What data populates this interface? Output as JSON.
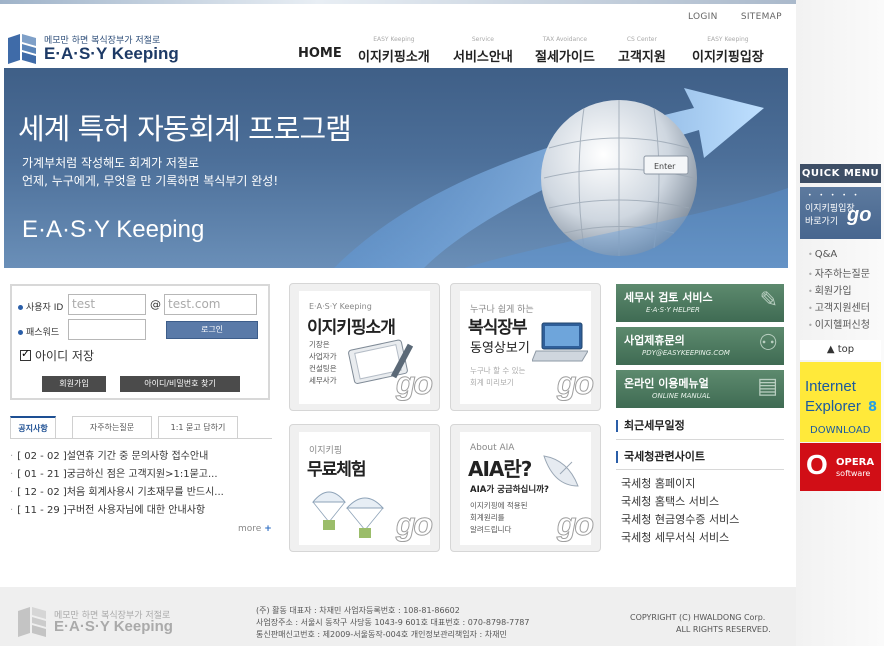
{
  "header": {
    "util_links": [
      "LOGIN",
      "SITEMAP"
    ],
    "logo_tagline": "메모만 하면 복식장부가 저절로",
    "logo_brand": "E·A·S·Y Keeping",
    "nav": [
      {
        "sub": "",
        "label": "HOME"
      },
      {
        "sub": "EASY Keeping",
        "label": "이지키핑소개"
      },
      {
        "sub": "Service",
        "label": "서비스안내"
      },
      {
        "sub": "TAX Avoidance",
        "label": "절세가이드"
      },
      {
        "sub": "CS Center",
        "label": "고객지원"
      },
      {
        "sub": "EASY Keeping",
        "label": "이지키핑입장"
      }
    ]
  },
  "hero": {
    "title": "세계 특허 자동회계 프로그램",
    "line1": "가계부처럼 작성해도 회계가 저절로",
    "line2": "언제, 누구에게, 무엇을 만 기록하면 복식부기 완성!",
    "brand": "E·A·S·Y Keeping",
    "enter_key": "Enter"
  },
  "login": {
    "id_label": "사용자 ID",
    "id_value": "test",
    "at": "@",
    "domain_value": "test.com",
    "pw_label": "패스워드",
    "login_button": "로그인",
    "save_id": "아이디 저장",
    "join_button": "회원가입",
    "find_button": "아이디/비밀번호 찾기"
  },
  "notice": {
    "tabs": [
      "공지사항",
      "자주하는질문",
      "1:1 묻고 답하기"
    ],
    "items": [
      "[ 02 - 02 ]설연휴 기간 중 문의사항 접수안내",
      "[ 01 - 21 ]궁금하신 점은 고객지원>1:1묻고...",
      "[ 12 - 02 ]처음 회계사용시 기초재무를 반드시...",
      "[ 11 - 29 ]구버전 사용자님에 대한 안내사항"
    ],
    "more": "more"
  },
  "boxes": {
    "intro": {
      "cap": "E·A·S·Y Keeping",
      "head": "이지키핑소개",
      "desc": "기장은\n사업자가\n컨설팅은\n세무사가",
      "go": "go"
    },
    "video": {
      "cap": "누구나 쉽게 하는",
      "head": "복식장부",
      "head2": "동영상보기",
      "desc": "누구나 할 수 있는\n회계 미리보기",
      "go": "go"
    },
    "trial": {
      "cap": "이지키핑",
      "head": "무료체험",
      "go": "go"
    },
    "aia": {
      "cap": "About AIA",
      "head": "AIA란?",
      "head2": "AIA가 궁금하십니까?",
      "desc": "이지키핑에 적용된\n회계원리를\n알려드립니다",
      "go": "go"
    }
  },
  "promos": [
    {
      "title": "세무사 검토 서비스",
      "sub": "E·A·S·Y HELPER"
    },
    {
      "title": "사업제휴문의",
      "sub": "PDY@EASYKEEPING.COM"
    },
    {
      "title": "온라인 이용메뉴얼",
      "sub": "ONLINE MANUAL"
    }
  ],
  "schedule_title": "최근세무일정",
  "tax_sites": {
    "title": "국세청관련사이트",
    "links": [
      "국세청 홈페이지",
      "국세청 홈택스 서비스",
      "국세청 현금영수증 서비스",
      "국세청 세무서식 서비스"
    ]
  },
  "quick_menu": {
    "title": "QUICK MENU",
    "go_line1": "이지키핑입장",
    "go_line2": "바로가기",
    "go_word": "go",
    "links": [
      "Q&A",
      "자주하는질문",
      "회원가입",
      "고객지원센터",
      "이지헬퍼신청"
    ],
    "top": "top"
  },
  "ie_banner": {
    "line1": "Internet",
    "line2": "Explorer",
    "version": "8",
    "download": "DOWNLOAD"
  },
  "opera_banner": {
    "logo": "O",
    "name": "OPERA",
    "sub": "software"
  },
  "footer": {
    "tagline": "메모만 하면 복식장부가 저절로",
    "brand": "E·A·S·Y Keeping",
    "line1": "(주) 활동    대표자 : 차재민    사업자등록번호 : 108-81-86602",
    "line2": "사업장주소 : 서울시 동작구 사당동 1043-9 601호    대표번호 : 070-8798-7787",
    "line3": "통신판매신고번호 : 제2009-서울동작-004호    개인정보관리책임자 : 차재민",
    "copyright1": "COPYRIGHT (C) HWALDONG Corp.",
    "copyright2": "ALL RIGHTS RESERVED."
  },
  "colors": {
    "brand_navy": "#1d3a66",
    "hero_blue": "#4c6f99",
    "promo_green": "#4f7b60",
    "ie_yellow": "#ffe93a",
    "opera_red": "#d10e16"
  }
}
